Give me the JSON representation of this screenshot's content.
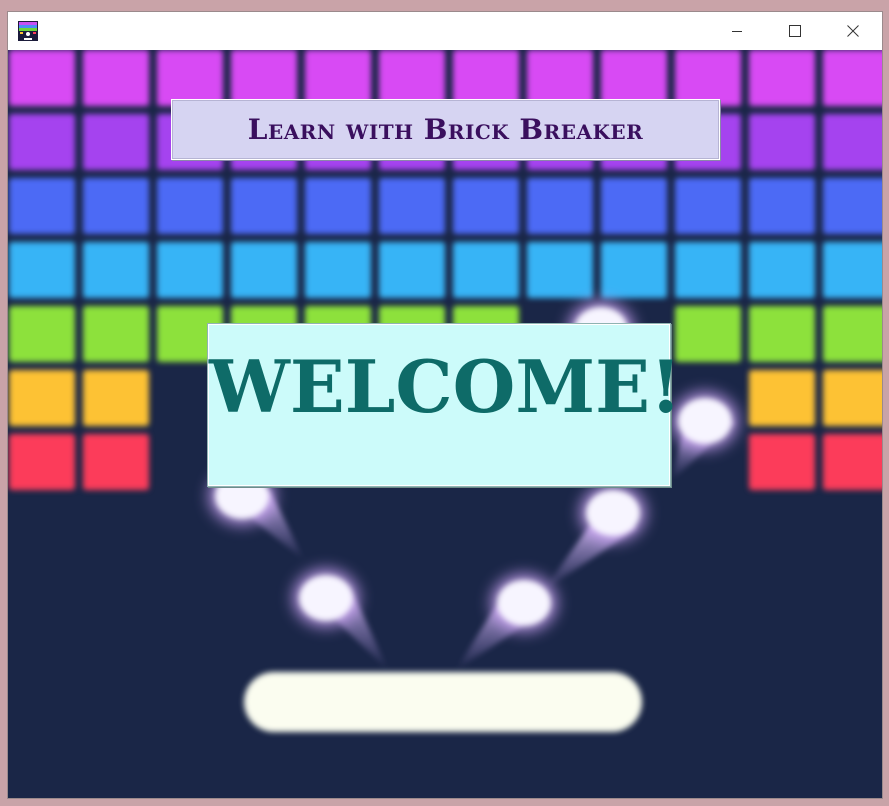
{
  "window": {
    "title": "",
    "app_icon": "brick-breaker-app-icon",
    "controls": {
      "minimize": "minimize-icon",
      "maximize": "maximize-icon",
      "close": "close-icon"
    }
  },
  "game": {
    "title_banner": "Learn with Brick Breaker",
    "welcome_message": "WELCOME!",
    "background_color": "#1a2647",
    "brick_row_colors": [
      "#d84af4",
      "#a543ef",
      "#4c6af5",
      "#37b4f6",
      "#8de13c",
      "#fdc234",
      "#fc3c5a"
    ],
    "ball_color": "#f7f5ff",
    "paddle_color": "#fbfdf0",
    "title_banner_color": "#d6d4f2",
    "title_text_color": "#3a0f5e",
    "welcome_box_color": "#ccfbfa",
    "welcome_text_color": "#0e6b68"
  }
}
